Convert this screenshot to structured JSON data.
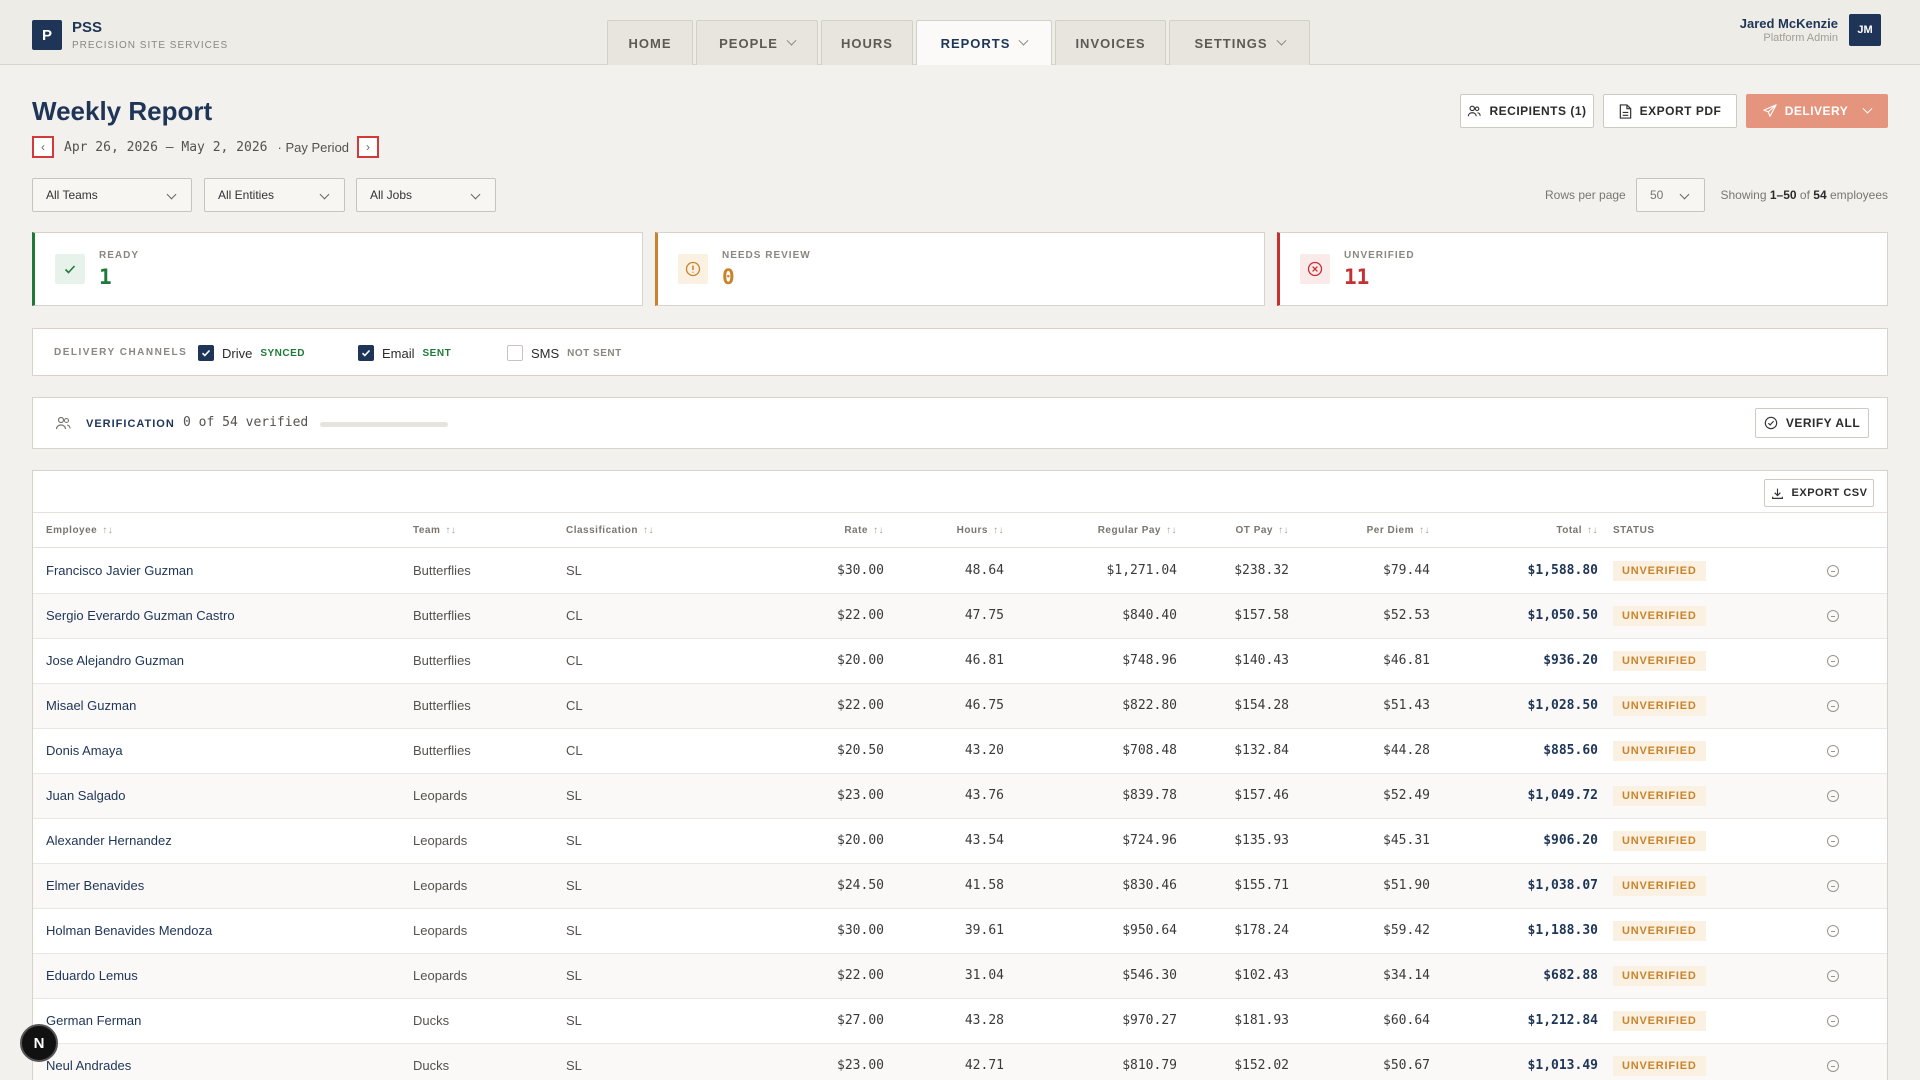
{
  "app": {
    "logo_letter": "P",
    "name": "PSS",
    "subtitle": "PRECISION SITE SERVICES"
  },
  "nav": {
    "tabs": [
      {
        "label": "HOME",
        "dropdown": false,
        "active": false
      },
      {
        "label": "PEOPLE",
        "dropdown": true,
        "active": false
      },
      {
        "label": "HOURS",
        "dropdown": false,
        "active": false
      },
      {
        "label": "REPORTS",
        "dropdown": true,
        "active": true
      },
      {
        "label": "INVOICES",
        "dropdown": false,
        "active": false
      },
      {
        "label": "SETTINGS",
        "dropdown": true,
        "active": false
      }
    ]
  },
  "user": {
    "name": "Jared McKenzie",
    "role": "Platform Admin",
    "initials": "JM"
  },
  "page": {
    "title": "Weekly Report",
    "prev_symbol": "‹",
    "next_symbol": "›",
    "date_range": "Apr 26, 2026 – May 2, 2026",
    "period_label": "· Pay Period"
  },
  "actions": {
    "recipients": "RECIPIENTS (1)",
    "export_pdf": "EXPORT PDF",
    "delivery": "DELIVERY"
  },
  "filters": {
    "teams": "All Teams",
    "entities": "All Entities",
    "jobs": "All Jobs",
    "rows_label": "Rows per page",
    "rows_value": "50",
    "showing_prefix": "Showing",
    "showing_range": "1–50",
    "showing_of": "of",
    "showing_count": "54",
    "showing_suffix": "employees"
  },
  "summary": {
    "ready": {
      "label": "READY",
      "value": "1",
      "color": "#1f7a3a"
    },
    "needs_review": {
      "label": "NEEDS REVIEW",
      "value": "0",
      "color": "#c9842b"
    },
    "unverified": {
      "label": "UNVERIFIED",
      "value": "11",
      "color": "#c53030"
    }
  },
  "channels": {
    "label": "DELIVERY CHANNELS",
    "items": [
      {
        "name": "Drive",
        "status": "SYNCED",
        "checked": true
      },
      {
        "name": "Email",
        "status": "SENT",
        "checked": true
      },
      {
        "name": "SMS",
        "status": "NOT SENT",
        "checked": false
      }
    ]
  },
  "verification": {
    "label": "VERIFICATION",
    "text": "0 of 54 verified",
    "progress": 0,
    "verify_all": "VERIFY ALL"
  },
  "table": {
    "export_csv": "EXPORT CSV",
    "headers": {
      "employee": "Employee",
      "team": "Team",
      "classification": "Classification",
      "rate": "Rate",
      "hours": "Hours",
      "regular_pay": "Regular Pay",
      "ot_pay": "OT Pay",
      "per_diem": "Per Diem",
      "total": "Total",
      "status": "STATUS"
    },
    "sort_symbol": "↑↓",
    "rows": [
      {
        "employee": "Francisco Javier Guzman",
        "team": "Butterflies",
        "classification": "SL",
        "rate": "$30.00",
        "hours": "48.64",
        "regular_pay": "$1,271.04",
        "ot_pay": "$238.32",
        "per_diem": "$79.44",
        "total": "$1,588.80",
        "status": "UNVERIFIED"
      },
      {
        "employee": "Sergio Everardo Guzman Castro",
        "team": "Butterflies",
        "classification": "CL",
        "rate": "$22.00",
        "hours": "47.75",
        "regular_pay": "$840.40",
        "ot_pay": "$157.58",
        "per_diem": "$52.53",
        "total": "$1,050.50",
        "status": "UNVERIFIED"
      },
      {
        "employee": "Jose Alejandro Guzman",
        "team": "Butterflies",
        "classification": "CL",
        "rate": "$20.00",
        "hours": "46.81",
        "regular_pay": "$748.96",
        "ot_pay": "$140.43",
        "per_diem": "$46.81",
        "total": "$936.20",
        "status": "UNVERIFIED"
      },
      {
        "employee": "Misael Guzman",
        "team": "Butterflies",
        "classification": "CL",
        "rate": "$22.00",
        "hours": "46.75",
        "regular_pay": "$822.80",
        "ot_pay": "$154.28",
        "per_diem": "$51.43",
        "total": "$1,028.50",
        "status": "UNVERIFIED"
      },
      {
        "employee": "Donis Amaya",
        "team": "Butterflies",
        "classification": "CL",
        "rate": "$20.50",
        "hours": "43.20",
        "regular_pay": "$708.48",
        "ot_pay": "$132.84",
        "per_diem": "$44.28",
        "total": "$885.60",
        "status": "UNVERIFIED"
      },
      {
        "employee": "Juan Salgado",
        "team": "Leopards",
        "classification": "SL",
        "rate": "$23.00",
        "hours": "43.76",
        "regular_pay": "$839.78",
        "ot_pay": "$157.46",
        "per_diem": "$52.49",
        "total": "$1,049.72",
        "status": "UNVERIFIED"
      },
      {
        "employee": "Alexander Hernandez",
        "team": "Leopards",
        "classification": "SL",
        "rate": "$20.00",
        "hours": "43.54",
        "regular_pay": "$724.96",
        "ot_pay": "$135.93",
        "per_diem": "$45.31",
        "total": "$906.20",
        "status": "UNVERIFIED"
      },
      {
        "employee": "Elmer Benavides",
        "team": "Leopards",
        "classification": "SL",
        "rate": "$24.50",
        "hours": "41.58",
        "regular_pay": "$830.46",
        "ot_pay": "$155.71",
        "per_diem": "$51.90",
        "total": "$1,038.07",
        "status": "UNVERIFIED"
      },
      {
        "employee": "Holman Benavides Mendoza",
        "team": "Leopards",
        "classification": "SL",
        "rate": "$30.00",
        "hours": "39.61",
        "regular_pay": "$950.64",
        "ot_pay": "$178.24",
        "per_diem": "$59.42",
        "total": "$1,188.30",
        "status": "UNVERIFIED"
      },
      {
        "employee": "Eduardo Lemus",
        "team": "Leopards",
        "classification": "SL",
        "rate": "$22.00",
        "hours": "31.04",
        "regular_pay": "$546.30",
        "ot_pay": "$102.43",
        "per_diem": "$34.14",
        "total": "$682.88",
        "status": "UNVERIFIED"
      },
      {
        "employee": "German Ferman",
        "team": "Ducks",
        "classification": "SL",
        "rate": "$27.00",
        "hours": "43.28",
        "regular_pay": "$970.27",
        "ot_pay": "$181.93",
        "per_diem": "$60.64",
        "total": "$1,212.84",
        "status": "UNVERIFIED"
      },
      {
        "employee": "Neul Andrades",
        "team": "Ducks",
        "classification": "SL",
        "rate": "$23.00",
        "hours": "42.71",
        "regular_pay": "$810.79",
        "ot_pay": "$152.02",
        "per_diem": "$50.67",
        "total": "$1,013.49",
        "status": "UNVERIFIED"
      }
    ]
  },
  "fab_label": "N"
}
